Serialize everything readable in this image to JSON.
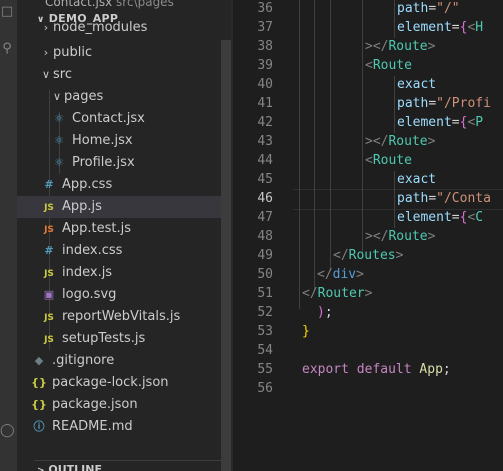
{
  "explorer": {
    "breadcrumb_file": "Contact.jsx",
    "breadcrumb_path": "src\\pages",
    "project": "DEMO_APP",
    "outline": "OUTLINE",
    "items": [
      {
        "label": "node_modules",
        "kind": "folder",
        "icon": "chevron-right-icon"
      },
      {
        "label": "public",
        "kind": "folder",
        "icon": "chevron-right-icon"
      },
      {
        "label": "src",
        "kind": "folder-open",
        "icon": "chevron-down-icon"
      },
      {
        "label": "pages",
        "kind": "folder-open",
        "icon": "chevron-down-icon"
      },
      {
        "label": "Contact.jsx",
        "kind": "react",
        "icon": "react-icon"
      },
      {
        "label": "Home.jsx",
        "kind": "react",
        "icon": "react-icon"
      },
      {
        "label": "Profile.jsx",
        "kind": "react",
        "icon": "react-icon"
      },
      {
        "label": "App.css",
        "kind": "css",
        "icon": "hash-icon"
      },
      {
        "label": "App.js",
        "kind": "js",
        "icon": "js-icon",
        "selected": true
      },
      {
        "label": "App.test.js",
        "kind": "test",
        "icon": "js-test-icon"
      },
      {
        "label": "index.css",
        "kind": "css",
        "icon": "hash-icon"
      },
      {
        "label": "index.js",
        "kind": "js",
        "icon": "js-icon"
      },
      {
        "label": "logo.svg",
        "kind": "svg",
        "icon": "svg-icon"
      },
      {
        "label": "reportWebVitals.js",
        "kind": "js",
        "icon": "js-icon"
      },
      {
        "label": "setupTests.js",
        "kind": "js",
        "icon": "js-icon"
      },
      {
        "label": ".gitignore",
        "kind": "git",
        "icon": "gitignore-icon"
      },
      {
        "label": "package-lock.json",
        "kind": "json",
        "icon": "json-icon"
      },
      {
        "label": "package.json",
        "kind": "json",
        "icon": "json-icon"
      },
      {
        "label": "README.md",
        "kind": "info",
        "icon": "info-icon"
      }
    ]
  },
  "editor": {
    "current_line": "46",
    "lines": [
      {
        "n": "36",
        "code": "path=\"/\""
      },
      {
        "n": "37",
        "code": "element={<H"
      },
      {
        "n": "38",
        "code": "></Route>"
      },
      {
        "n": "39",
        "code": "<Route"
      },
      {
        "n": "40",
        "code": "exact"
      },
      {
        "n": "41",
        "code": "path=\"/Profi"
      },
      {
        "n": "42",
        "code": "element={<P"
      },
      {
        "n": "43",
        "code": "></Route>"
      },
      {
        "n": "44",
        "code": "<Route"
      },
      {
        "n": "45",
        "code": "exact"
      },
      {
        "n": "46",
        "code": "path=\"/Conta"
      },
      {
        "n": "47",
        "code": "element={<C"
      },
      {
        "n": "48",
        "code": "></Route>"
      },
      {
        "n": "49",
        "code": "</Routes>"
      },
      {
        "n": "50",
        "code": "</div>"
      },
      {
        "n": "51",
        "code": "</Router>"
      },
      {
        "n": "52",
        "code": ");"
      },
      {
        "n": "53",
        "code": "}"
      },
      {
        "n": "54",
        "code": ""
      },
      {
        "n": "55",
        "code": "export default App;"
      },
      {
        "n": "56",
        "code": ""
      }
    ]
  },
  "colors": {
    "react": "#519aba",
    "css": "#519aba",
    "js": "#cbcb41",
    "test": "#e37933",
    "svg": "#a074c4",
    "json": "#cbcb41",
    "git": "#6d8086",
    "info": "#519aba"
  }
}
